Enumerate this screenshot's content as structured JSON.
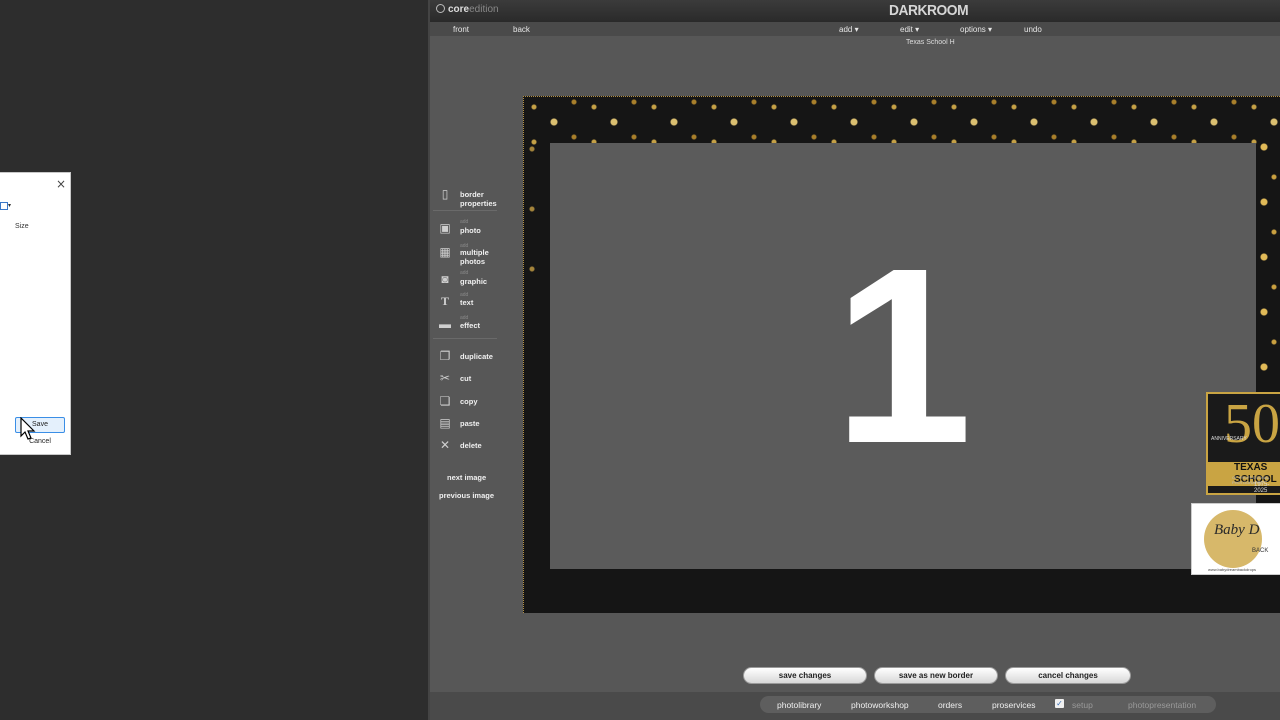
{
  "dialog": {
    "close_glyph": "×",
    "size_label": "Size",
    "save_label": "Save",
    "cancel_label": "Cancel"
  },
  "app": {
    "logo_bold": "core",
    "logo_light": "edition",
    "brand": "DARKROOM",
    "tabs": [
      "front",
      "back"
    ],
    "menus": [
      "add ▾",
      "edit ▾",
      "options ▾",
      "undo"
    ],
    "document_title": "Texas School H"
  },
  "tools": {
    "items": [
      {
        "sub": "",
        "label": "border\nproperties",
        "icon": "page-icon"
      },
      {
        "sub": "add",
        "label": "photo",
        "icon": "portrait-icon"
      },
      {
        "sub": "add",
        "label": "multiple\nphotos",
        "icon": "grid-icon"
      },
      {
        "sub": "add",
        "label": "graphic",
        "icon": "graphic-icon"
      },
      {
        "sub": "add",
        "label": "text",
        "icon": "text-icon"
      },
      {
        "sub": "add",
        "label": "effect",
        "icon": "effect-icon"
      },
      {
        "sub": "",
        "label": "duplicate",
        "icon": "duplicate-icon"
      },
      {
        "sub": "",
        "label": "cut",
        "icon": "scissors-icon"
      },
      {
        "sub": "",
        "label": "copy",
        "icon": "copy-icon"
      },
      {
        "sub": "",
        "label": "paste",
        "icon": "paste-icon"
      },
      {
        "sub": "",
        "label": "delete",
        "icon": "delete-icon"
      }
    ],
    "next_image": "next image",
    "previous_image": "previous image"
  },
  "canvas": {
    "placeholder_number": "1"
  },
  "logos": {
    "fifty": {
      "number": "50",
      "anniversary": "ANNIVERSARY",
      "name": "TEXAS SCHOOL",
      "sub": "OF PROFESSIONAL PHOTOGRAPHY",
      "years": "1975-2025"
    },
    "baby": {
      "script": "Baby D",
      "back": "BACK",
      "url": "www.babydreambackdrops"
    }
  },
  "actions": {
    "save_changes": "save changes",
    "save_as_new_border": "save as new border",
    "cancel_changes": "cancel changes"
  },
  "bottom_nav": {
    "items": [
      "photolibrary",
      "photoworkshop",
      "orders",
      "proservices"
    ],
    "setup": "setup",
    "photopresentation": "photopresentation"
  }
}
